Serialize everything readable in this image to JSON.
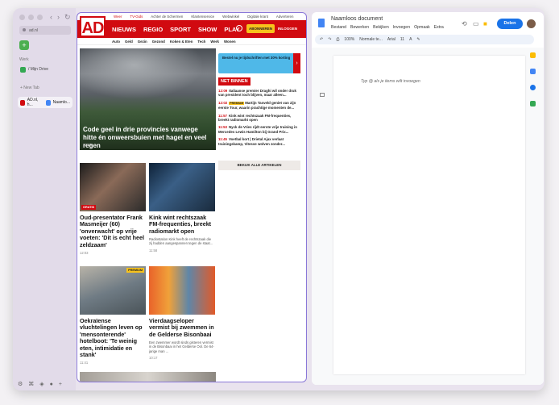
{
  "sidebar": {
    "url": "ad.nl",
    "space_label": "+",
    "section_work": "Werk",
    "drive_label": "/ Mijn Drive",
    "new_tab": "+ New Tab",
    "tab_ad": "AD.nl, h...",
    "tab_docs": "Naamlo...",
    "nav_back": "‹",
    "nav_forward": "›",
    "reload": "↻",
    "bottom_icons": [
      "⚙",
      "⌘",
      "◈",
      "●",
      "+"
    ]
  },
  "ad": {
    "top_links": [
      "Weer",
      "TV-Gids",
      "Achter de Schermen",
      "Klantenservice",
      "Webwinkel",
      "Digitale krant",
      "Adverteren"
    ],
    "logo": "AD",
    "menu": [
      "NIEUWS",
      "REGIO",
      "SPORT",
      "SHOW",
      "PLAY"
    ],
    "abonneren": "ABONNEREN",
    "inloggen": "INLOGGEN",
    "sub_menu": [
      "Auto",
      "Geld",
      "Gezin",
      "Gezond",
      "Koken & Eten",
      "Tech",
      "Werk",
      "Wonen"
    ],
    "hero_title": "Code geel in drie provincies vanwege hitte én onweersbuien met hagel en veel regen",
    "hero_time": "12:09",
    "banner_text": "Bestel nu je tijdschriften met 30% korting",
    "net_binnen": "NET BINNEN",
    "news": [
      {
        "time": "12:09",
        "badge": "",
        "text": "Italiaanse premier Draghi wil onder druk van president toch blijven, maar alleen..."
      },
      {
        "time": "12:02",
        "badge": "PREMIUM",
        "text": "Martijn Tasveld geniet van zijn eerste Tour, waarin prachtige momenten de..."
      },
      {
        "time": "11:57",
        "badge": "",
        "text": "Kink wint rechtszaak FM-frequenties, breekt radiomarkt open"
      },
      {
        "time": "11:53",
        "badge": "",
        "text": "Nyck de Vries rijdt eerste vrije training in Mercedes Lewis Hamilton bij Grand Prix..."
      },
      {
        "time": "11:45",
        "badge": "",
        "text": "Voetbal kort | Drietal Ajax verlaat trainingskamp, Vitesse wolven zonder..."
      }
    ],
    "all_articles": "BEKIJK ALLE ARTIKELEN",
    "cards": [
      {
        "title": "Oud-presentator Frank Masmeijer (60) 'onverwacht' op vrije voeten: 'Dit is echt heel zeldzaam'",
        "time": "12:03",
        "badge": "GRATIS",
        "summary": ""
      },
      {
        "title": "Kink wint rechtszaak FM-frequenties, breekt radiomarkt open",
        "time": "11:58",
        "badge": "",
        "summary": "Radiostation Kink heeft de rechtszaak die zij hadden aangespannen tegen de staat..."
      },
      {
        "title": "Oekraïense vluchtelingen leven op 'mensonterende' hotelboot: 'Te weinig eten, intimidatie en stank'",
        "time": "11:41",
        "badge": "PREMIUM",
        "summary": ""
      },
      {
        "title": "Vierdaagseloper vermist bij zwemmen in de Gelderse Bisonbaai",
        "time": "10:17",
        "badge": "",
        "summary": "Een zwemmer wordt sinds gisteren vermist in de Bisonbaai in het Gelderse Ool. De 64-jarige man ..."
      }
    ]
  },
  "docs": {
    "title": "Naamloos document",
    "menu": [
      "Bestand",
      "Bewerken",
      "Bekijken",
      "Invoegen",
      "Opmaak",
      "Extra"
    ],
    "share": "Delen",
    "zoom": "100%",
    "style": "Normale te...",
    "font": "Arial",
    "size": "11",
    "hint": "Typ @ als je items wilt invoegen",
    "tools": [
      "↶",
      "↷",
      "⎙",
      "A",
      "✎"
    ]
  }
}
